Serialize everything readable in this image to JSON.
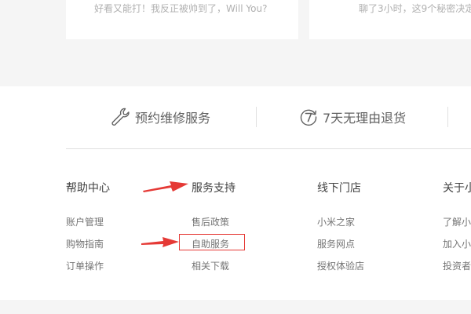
{
  "top_cards": {
    "left_text": "好看又能打！我反正被帅到了，Will You?",
    "right_text": "聊了3小时，这9个秘密决定"
  },
  "services": [
    {
      "label": "预约维修服务",
      "icon": "wrench-icon"
    },
    {
      "label": "7天无理由退货",
      "icon": "seven-day-return-icon"
    }
  ],
  "columns": [
    {
      "title": "帮助中心",
      "links": [
        "账户管理",
        "购物指南",
        "订单操作"
      ]
    },
    {
      "title": "服务支持",
      "links": [
        "售后政策",
        "自助服务",
        "相关下载"
      ]
    },
    {
      "title": "线下门店",
      "links": [
        "小米之家",
        "服务网点",
        "授权体验店"
      ]
    },
    {
      "title": "关于小",
      "links": [
        "了解小",
        "加入小",
        "投资者"
      ]
    }
  ],
  "annotation_color": "#e53935"
}
